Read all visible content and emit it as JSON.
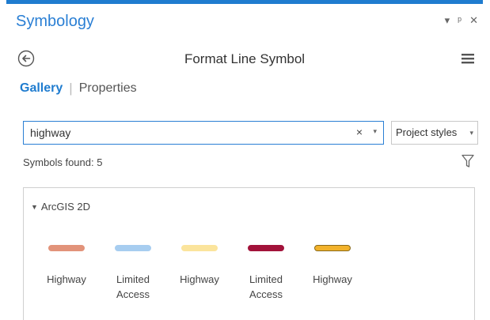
{
  "pane": {
    "title": "Symbology",
    "controls": [
      "▾",
      "ᵖ",
      "✕"
    ]
  },
  "header": {
    "title": "Format Line Symbol"
  },
  "tabs": {
    "gallery": "Gallery",
    "properties": "Properties"
  },
  "search": {
    "value": "highway",
    "clear": "×",
    "caret": "▾"
  },
  "styles_dropdown": {
    "value": "Project styles",
    "caret": "▾"
  },
  "results": {
    "found": "Symbols found: 5"
  },
  "gallery": {
    "group_label": "ArcGIS 2D",
    "group_chevron": "▼",
    "symbols": [
      {
        "label": "Highway",
        "color": "#e2937a",
        "outline": "#e2937a"
      },
      {
        "label": "Limited\nAccess",
        "color": "#a7cdf0",
        "outline": "#a7cdf0"
      },
      {
        "label": "Highway",
        "color": "#fbe49c",
        "outline": "#fbe49c"
      },
      {
        "label": "Limited\nAccess",
        "color": "#a2123a",
        "outline": "#a2123a"
      },
      {
        "label": "Highway",
        "color": "#f2b22b",
        "outline": "#8a6a1a"
      }
    ]
  },
  "colors": {
    "accent": "#1f7ccf",
    "title": "#2a7fd4"
  },
  "icons": {
    "back": "back-arrow-icon",
    "menu": "hamburger-menu-icon",
    "filter": "filter-funnel-icon"
  }
}
